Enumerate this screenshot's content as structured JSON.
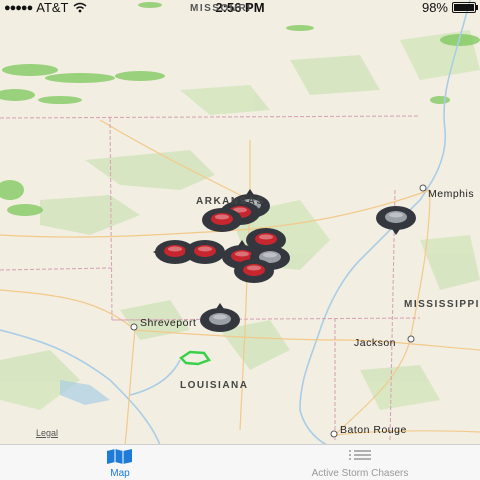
{
  "status_bar": {
    "carrier": "AT&T",
    "time": "2:56 PM",
    "battery": "98%",
    "battery_level": 0.98
  },
  "map": {
    "state_labels": [
      "ARKANSAS",
      "LOUISIANA",
      "MISSISSIPPI",
      "MISSOURI"
    ],
    "city_labels": [
      "Shreveport",
      "Jackson",
      "Baton Rouge",
      "Memphis"
    ],
    "legal_link": "Legal",
    "marker_color": "#c8262e",
    "outline_color": "#3ad14a"
  },
  "tabs": [
    {
      "label": "Map",
      "icon": "map-icon",
      "active": true
    },
    {
      "label": "Active Storm Chasers",
      "icon": "list-icon",
      "active": false
    }
  ]
}
